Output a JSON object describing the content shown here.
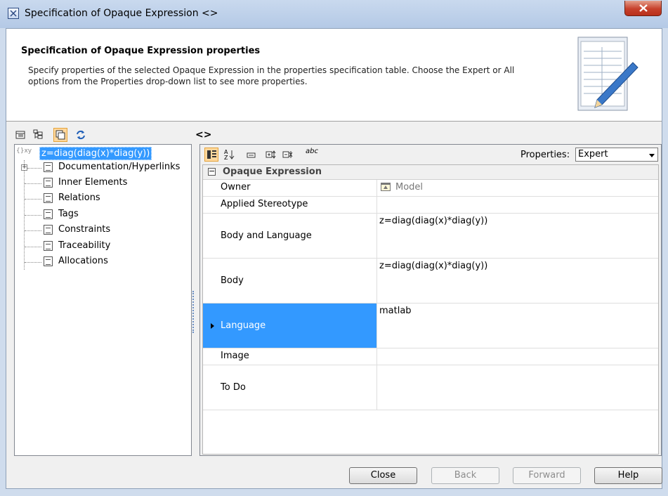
{
  "window": {
    "title": "Specification of Opaque Expression <>",
    "close_label": "x"
  },
  "header": {
    "title": "Specification of Opaque Expression properties",
    "description": "Specify properties of the selected Opaque Expression in the properties specification table. Choose the Expert or All options from the Properties drop-down list to see more properties."
  },
  "left_toolbar": {
    "icons": [
      "list-view-icon",
      "tree-view-icon",
      "copy-view-icon",
      "refresh-icon"
    ]
  },
  "panel_title": "<>",
  "tree": {
    "root_label": "z=diag(diag(x)*diag(y))",
    "root_icon_text": "{}xy",
    "items": [
      {
        "label": "Documentation/Hyperlinks"
      },
      {
        "label": "Inner Elements"
      },
      {
        "label": "Relations"
      },
      {
        "label": "Tags"
      },
      {
        "label": "Constraints"
      },
      {
        "label": "Traceability"
      },
      {
        "label": "Allocations"
      }
    ]
  },
  "right_toolbar": {
    "icons": [
      "categorized-icon",
      "sort-alpha-icon",
      "description-icon",
      "expand-all-icon",
      "collapse-all-icon",
      "spelling-icon"
    ],
    "spelling_label": "abc",
    "properties_label": "Properties:",
    "properties_value": "Expert"
  },
  "grid": {
    "group_label": "Opaque Expression",
    "group_toggle": "−",
    "rows": [
      {
        "name": "Owner",
        "value": "Model"
      },
      {
        "name": "Applied Stereotype",
        "value": ""
      },
      {
        "name": "Body and Language",
        "value": "z=diag(diag(x)*diag(y))"
      },
      {
        "name": "Body",
        "value": "z=diag(diag(x)*diag(y))"
      },
      {
        "name": "Language",
        "value": "matlab"
      },
      {
        "name": "Image",
        "value": ""
      },
      {
        "name": "To Do",
        "value": ""
      }
    ]
  },
  "footer": {
    "close": "Close",
    "back": "Back",
    "forward": "Forward",
    "help": "Help"
  },
  "colors": {
    "selection": "#3399ff",
    "active_tool": "#ffd89e"
  }
}
